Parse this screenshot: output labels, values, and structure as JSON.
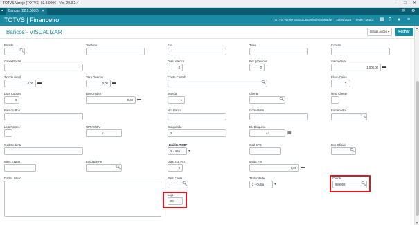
{
  "window": {
    "title": "TOTVS Varejo (TOTVS) 02.8.0006 - Ver. 20.3.2.4",
    "controls": {
      "minimize": "–",
      "maximize": "□",
      "close": "✕"
    }
  },
  "tabbar": {
    "tab_label": "Bancos (02.9.0006)",
    "tab_close": "✕",
    "icons": {
      "left": "app-icon",
      "mail": "mail-icon",
      "settings": "gear-icon"
    }
  },
  "header": {
    "brand": "TOTVS | Financeiro",
    "product": "TOTVS Varejo MSSQL Brasil",
    "user": "Administrador",
    "date": "16/04/2024",
    "branch": "Teste / Matriz",
    "icons": [
      "grid-icon",
      "help-icon",
      "user-icon",
      "menu-icon"
    ]
  },
  "page": {
    "title": "Bancos - VISUALIZAR",
    "more_actions": "Outras Ações",
    "more_actions_caret": "▾",
    "close": "Fechar"
  },
  "fields": {
    "estado": {
      "label": "Estado",
      "value": ""
    },
    "telefone": {
      "label": "Telefone",
      "value": ""
    },
    "fax": {
      "label": "Fax",
      "value": ""
    },
    "telex": {
      "label": "Telex",
      "value": ""
    },
    "contato": {
      "label": "Contato",
      "value": ""
    },
    "caixa_postal": {
      "label": "Caixa Postal",
      "value": ""
    },
    "dias_retencao": {
      "label": "Dias retenca",
      "value": "0"
    },
    "ret_descon": {
      "label": "Ret.p/Descon",
      "value": "0"
    },
    "saldo_atual": {
      "label": "Saldo Atual",
      "value": "1.000,00"
    },
    "tx_cob_simpl": {
      "label": "Tx cob simpl",
      "value": "0,00"
    },
    "taxa_descon": {
      "label": "Taxa Descon.",
      "value": "0,00"
    },
    "conta_contab": {
      "label": "Conta Contab",
      "value": ""
    },
    "fluxo_caixa": {
      "label": "Fluxo Caixa",
      "value": ""
    },
    "dias_cobran": {
      "label": "Dias Cobran.",
      "value": "0"
    },
    "lim_credito": {
      "label": "Lim.Credito",
      "value": "0,00"
    },
    "moeda": {
      "label": "Moeda",
      "value": "1"
    },
    "cliente_1": {
      "label": "Cliente",
      "value": ""
    },
    "unid_cliente": {
      "label": "Unid Cliente",
      "value": ""
    },
    "pais_bco": {
      "label": "Pais do Bco",
      "value": ""
    },
    "nro_banco": {
      "label": "Nro Banco",
      "value": ""
    },
    "correntista": {
      "label": "Correntista",
      "value": ""
    },
    "fornecedor": {
      "label": "Fornecedor",
      "value": ""
    },
    "loja_fornec": {
      "label": "Loja Fornec",
      "value": ""
    },
    "cpf_cnpj": {
      "label": "CPF/CNPJ",
      "value": "/   -"
    },
    "bloqueado": {
      "label": "Bloqueado",
      "value": "2"
    },
    "dt_bloqueio": {
      "label": "Dt. Bloqueio",
      "value": "/ /"
    },
    "cod_cedente": {
      "label": "Cod Cedente",
      "value": ""
    },
    "habilita_ticb": {
      "label": "Habilita TICB*",
      "value": "2 - Não"
    },
    "cod_spb": {
      "label": "Cod SPB",
      "value": ""
    },
    "bco_oficial": {
      "label": "Bco Oficial",
      "value": ""
    },
    "ident_export": {
      "label": "Ident.Export",
      "value": ""
    },
    "entidade_fe": {
      "label": "Entidade Fe",
      "value": ""
    },
    "dias_exp_pix": {
      "label": "Dias Exp PIX",
      "value": "0"
    },
    "multa_pix": {
      "label": "Multa PIX",
      "value": "0,00"
    },
    "dados_intern": {
      "label": "Dados Intern.",
      "value": ""
    },
    "pais_conta": {
      "label": "País Conta",
      "value": ""
    },
    "titularidade": {
      "label": "Titularidade",
      "value": "2 - Outra"
    },
    "cliente_2": {
      "label": "Cliente",
      "value": "999999"
    },
    "loja": {
      "label": "Loja",
      "value": "99"
    }
  },
  "icons": {
    "search": "search-icon",
    "money": "money-icon",
    "calendar": "calendar-icon",
    "dropdown": "chevron-down-icon"
  },
  "colors": {
    "brand": "#1a8ba3",
    "tabbar": "#0b5c6e",
    "highlight": "#e0161d"
  }
}
